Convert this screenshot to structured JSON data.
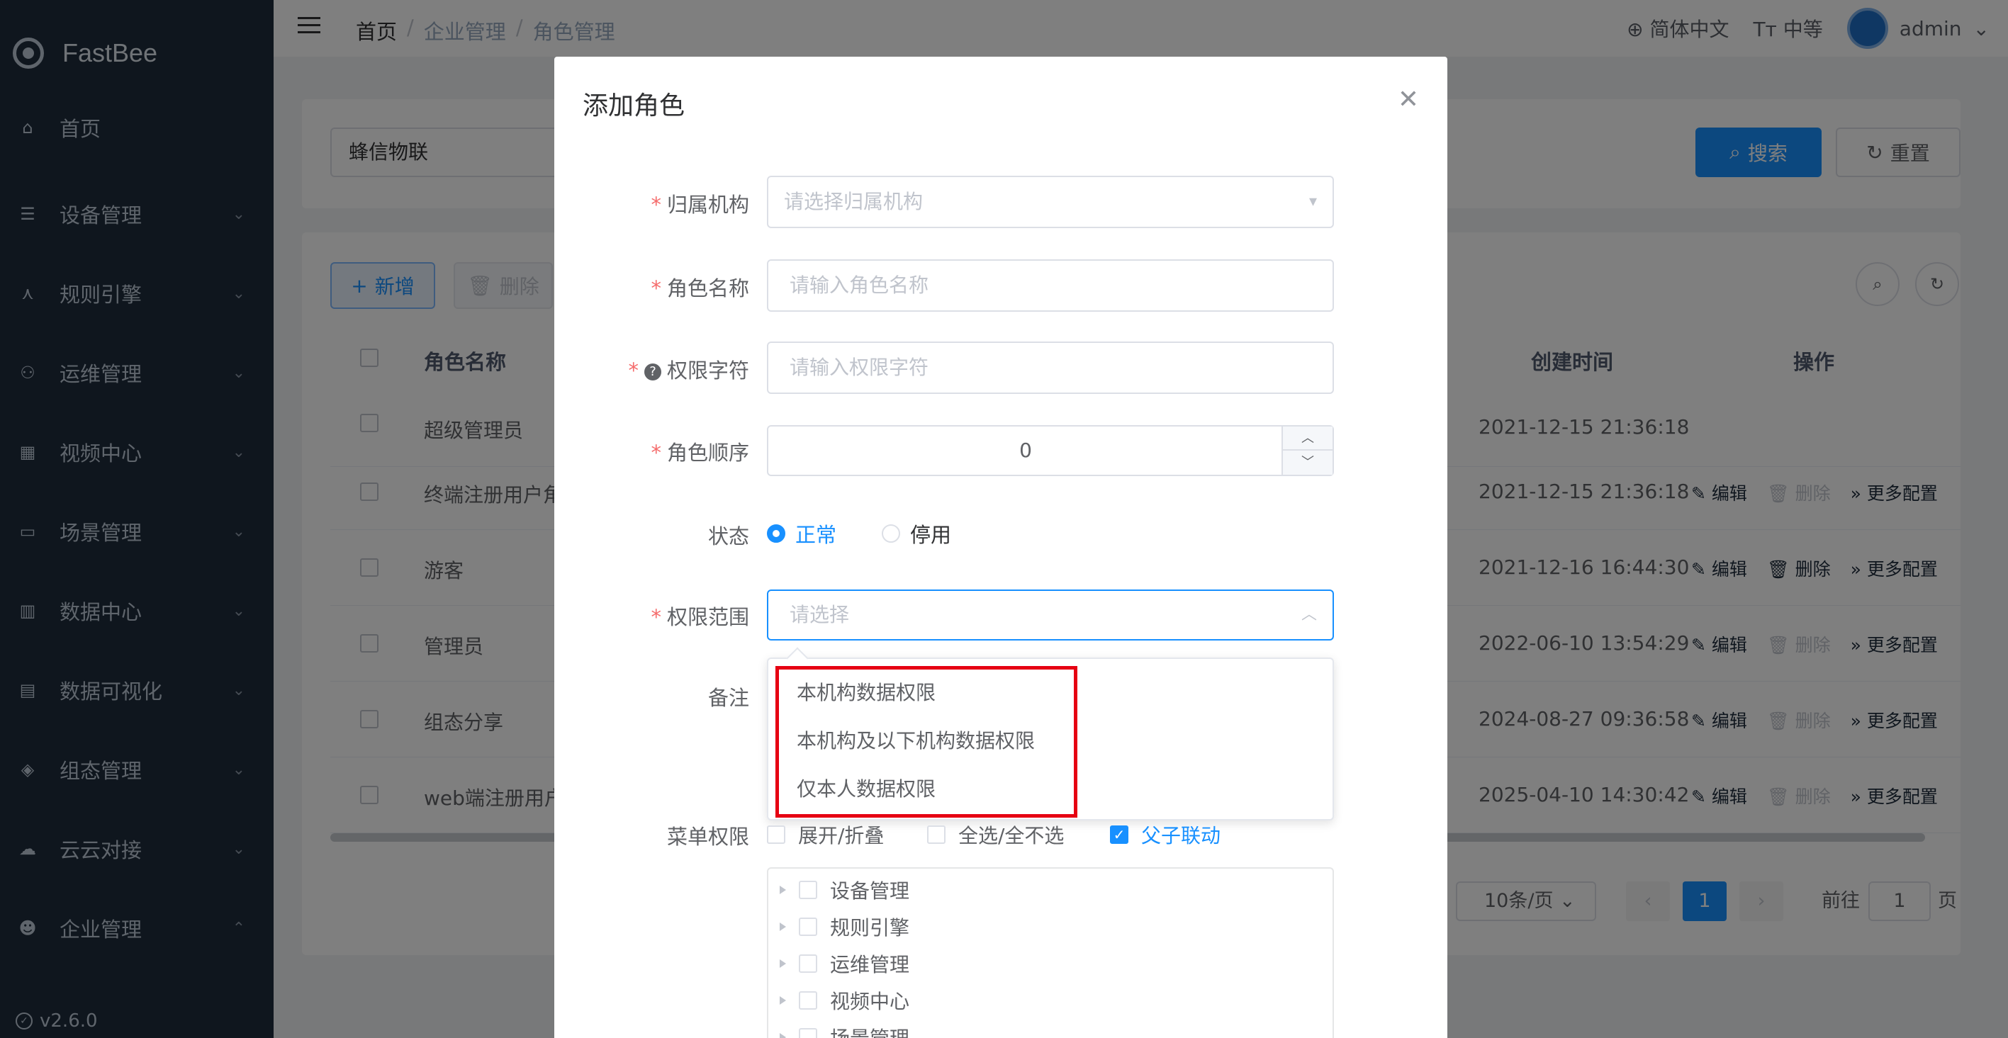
{
  "app": {
    "brand": "FastBee",
    "version": "v2.6.0"
  },
  "sidebar": {
    "items": [
      {
        "label": "首页",
        "icon": "home-icon"
      },
      {
        "label": "设备管理",
        "icon": "device-icon"
      },
      {
        "label": "规则引擎",
        "icon": "rule-icon"
      },
      {
        "label": "运维管理",
        "icon": "ops-icon"
      },
      {
        "label": "视频中心",
        "icon": "video-icon"
      },
      {
        "label": "场景管理",
        "icon": "scene-icon"
      },
      {
        "label": "数据中心",
        "icon": "data-icon"
      },
      {
        "label": "数据可视化",
        "icon": "visual-icon"
      },
      {
        "label": "组态管理",
        "icon": "layers-icon"
      },
      {
        "label": "云云对接",
        "icon": "cloud-icon"
      },
      {
        "label": "企业管理",
        "icon": "enterprise-icon"
      }
    ]
  },
  "topbar": {
    "breadcrumb": [
      "首页",
      "企业管理",
      "角色管理"
    ],
    "language": "简体中文",
    "size": "中等",
    "user": "admin"
  },
  "page": {
    "search_value": "蜂信物联",
    "search_btn": "搜索",
    "reset_btn": "重置",
    "add_btn": "新增",
    "delete_btn": "删除",
    "columns": {
      "name": "角色名称",
      "created": "创建时间",
      "ops": "操作"
    },
    "rows": [
      {
        "name": "超级管理员",
        "created": "2021-12-15 21:36:18",
        "show_ops": false
      },
      {
        "name": "终端注册用户角",
        "created": "2021-12-15 21:36:18",
        "show_ops": true,
        "delete_enabled": false
      },
      {
        "name": "游客",
        "created": "2021-12-16 16:44:30",
        "show_ops": true,
        "delete_enabled": true
      },
      {
        "name": "管理员",
        "created": "2022-06-10 13:54:29",
        "show_ops": true,
        "delete_enabled": false
      },
      {
        "name": "组态分享",
        "created": "2024-08-27 09:36:58",
        "show_ops": true,
        "delete_enabled": false
      },
      {
        "name": "web端注册用户",
        "created": "2025-04-10 14:30:42",
        "show_ops": true,
        "delete_enabled": false
      }
    ],
    "op_labels": {
      "edit": "编辑",
      "delete": "删除",
      "more": "更多配置"
    },
    "pager": {
      "page_size": "10条/页",
      "current": "1",
      "goto_label": "前往",
      "goto_value": "1",
      "page_unit": "页"
    }
  },
  "dialog": {
    "title": "添加角色",
    "fields": {
      "org": {
        "label": "归属机构",
        "placeholder": "请选择归属机构"
      },
      "role_name": {
        "label": "角色名称",
        "placeholder": "请输入角色名称"
      },
      "perm_key": {
        "label": "权限字符",
        "placeholder": "请输入权限字符"
      },
      "order": {
        "label": "角色顺序",
        "value": "0"
      },
      "status": {
        "label": "状态",
        "options": [
          "正常",
          "停用"
        ],
        "selected": "正常"
      },
      "scope": {
        "label": "权限范围",
        "placeholder": "请选择"
      },
      "remark": {
        "label": "备注"
      },
      "menu": {
        "label": "菜单权限",
        "expand": "展开/折叠",
        "select_all": "全选/全不选",
        "linkage": "父子联动"
      }
    },
    "scope_options": [
      "本机构数据权限",
      "本机构及以下机构数据权限",
      "仅本人数据权限"
    ],
    "menu_tree": [
      "设备管理",
      "规则引擎",
      "运维管理",
      "视频中心",
      "场景管理"
    ]
  },
  "colors": {
    "primary": "#1890ff",
    "sidebar_bg": "#1f2d3d",
    "highlight_box": "#e60012"
  }
}
